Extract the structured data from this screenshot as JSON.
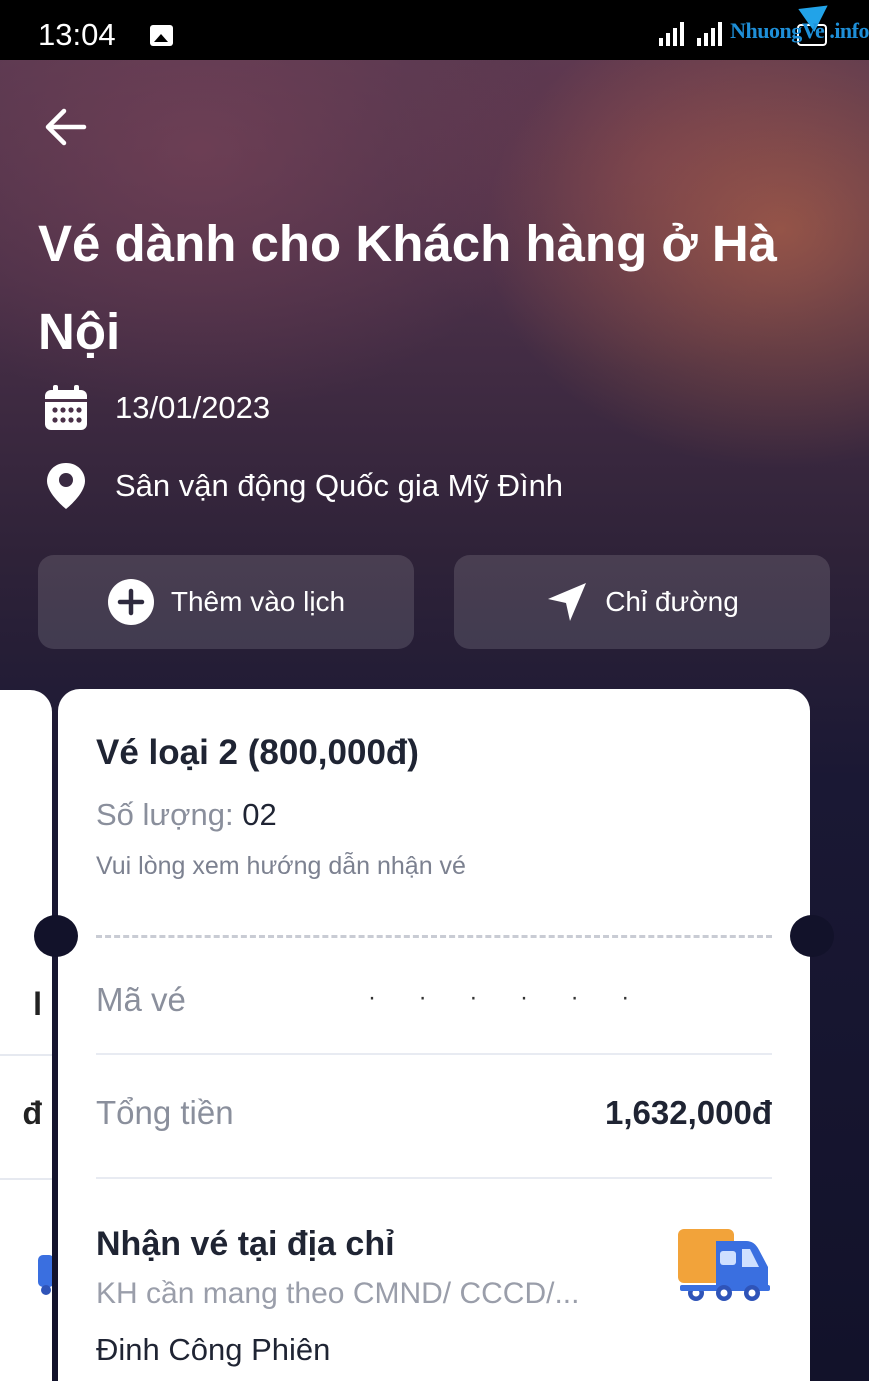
{
  "status_bar": {
    "time": "13:04",
    "network": "4G",
    "watermark": "NhuongVe .info"
  },
  "header": {
    "title": "Vé dành cho Khách hàng ở Hà Nội",
    "date": "13/01/2023",
    "venue": "Sân vận động Quốc gia Mỹ Đình"
  },
  "actions": {
    "add_calendar_label": "Thêm vào lịch",
    "directions_label": "Chỉ đường"
  },
  "prev_card": {
    "fragment_1": "l",
    "fragment_2": "đ"
  },
  "ticket": {
    "type": "Vé loại 2 (800,000đ)",
    "quantity_label": "Số lượng: ",
    "quantity_value": "02",
    "guide_text": "Vui lòng xem hướng dẫn nhận vé",
    "code_label": "Mã vé",
    "code_value": "· ·  · ·  ·  ·",
    "total_label": "Tổng tiền",
    "total_value": "1,632,000đ",
    "pickup_title": "Nhận vé tại địa chỉ",
    "pickup_note": "KH cần mang theo CMND/ CCCD/...",
    "pickup_name": "Đinh Công Phiên"
  },
  "icons": {
    "back": "arrow-left-icon",
    "calendar": "calendar-icon",
    "location": "location-pin-icon",
    "add": "plus-circle-icon",
    "directions": "navigation-arrow-icon",
    "delivery": "truck-icon"
  },
  "colors": {
    "card_bg": "#ffffff",
    "text_dark": "#1f2433",
    "text_muted": "#8a8f9c",
    "truck_blue": "#3a6fe0",
    "truck_orange": "#f2a33a"
  }
}
